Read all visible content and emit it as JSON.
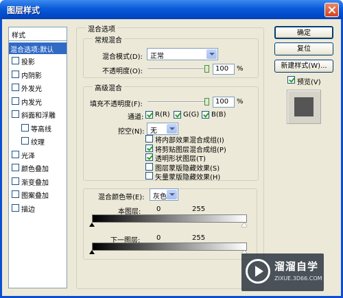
{
  "window": {
    "title": "图层样式"
  },
  "left_panel": {
    "header": "样式",
    "selected": "混合选项:默认",
    "items": [
      {
        "label": "投影",
        "indent": false
      },
      {
        "label": "内阴影",
        "indent": false
      },
      {
        "label": "外发光",
        "indent": false
      },
      {
        "label": "内发光",
        "indent": false
      },
      {
        "label": "斜面和浮雕",
        "indent": false
      },
      {
        "label": "等高线",
        "indent": true
      },
      {
        "label": "纹理",
        "indent": true
      },
      {
        "label": "光泽",
        "indent": false
      },
      {
        "label": "颜色叠加",
        "indent": false
      },
      {
        "label": "渐变叠加",
        "indent": false
      },
      {
        "label": "图案叠加",
        "indent": false
      },
      {
        "label": "描边",
        "indent": false
      }
    ]
  },
  "blend_options": {
    "title": "混合选项",
    "general": {
      "title": "常规混合",
      "mode_label": "混合模式(D):",
      "mode_value": "正常",
      "opacity_label": "不透明度(O):",
      "opacity_value": "100",
      "opacity_unit": "%",
      "opacity_level": 1.0
    },
    "advanced": {
      "title": "高级混合",
      "fill_label": "填充不透明度(F):",
      "fill_value": "100",
      "fill_unit": "%",
      "fill_level": 1.0,
      "channels_label": "通道:",
      "channels": [
        {
          "label": "R(R)",
          "checked": true
        },
        {
          "label": "G(G)",
          "checked": true
        },
        {
          "label": "B(B)",
          "checked": true
        }
      ],
      "knockout_label": "挖空(N):",
      "knockout_value": "无",
      "options": [
        {
          "label": "将内部效果混合成组(I)",
          "checked": false
        },
        {
          "label": "将剪贴图层混合成组(P)",
          "checked": true
        },
        {
          "label": "透明形状图层(T)",
          "checked": true
        },
        {
          "label": "图层蒙版隐藏效果(S)",
          "checked": false
        },
        {
          "label": "矢量蒙版隐藏效果(H)",
          "checked": false
        }
      ]
    },
    "blend_if": {
      "label": "混合颜色带(E):",
      "value": "灰色",
      "this_layer_label": "本图层:",
      "this_layer_min": "0",
      "this_layer_max": "255",
      "under_layer_label": "下一图层:",
      "under_layer_min": "0",
      "under_layer_max": "255"
    }
  },
  "buttons": {
    "ok": "确定",
    "reset": "复位",
    "new_style": "新建样式(W)...",
    "preview_label": "预览(V)",
    "preview_checked": true
  },
  "watermark": {
    "name": "溜溜自学",
    "url": "ZIXUE.3D66.COM"
  },
  "colors": {
    "selection": "#316ac5",
    "titlebar": "#0a5ad8",
    "dialog": "#ece9d8"
  }
}
